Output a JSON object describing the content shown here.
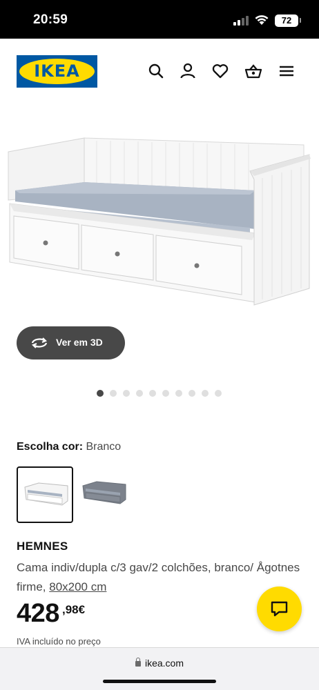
{
  "status_bar": {
    "time": "20:59",
    "battery": "72"
  },
  "header": {
    "logo_text": "IKEA",
    "icons": [
      "search-icon",
      "user-icon",
      "heart-icon",
      "basket-icon",
      "menu-icon"
    ]
  },
  "gallery": {
    "view_3d_label": "Ver em 3D",
    "dot_count": 10,
    "active_index": 0
  },
  "color": {
    "label": "Escolha cor:",
    "value": "Branco",
    "swatches": [
      "Branco",
      "Cinza"
    ]
  },
  "product": {
    "name": "HEMNES",
    "description": "Cama indiv/dupla c/3 gav/2 colchões, branco/ Ågotnes firme,",
    "dimensions": "80x200 cm",
    "price_int": "428",
    "price_dec": ",98€",
    "vat_note": "IVA incluído no preço"
  },
  "browser": {
    "url": "ikea.com"
  },
  "colors": {
    "ikea_blue": "#0058a3",
    "ikea_yellow": "#ffdb00",
    "button_dark": "#484848"
  }
}
